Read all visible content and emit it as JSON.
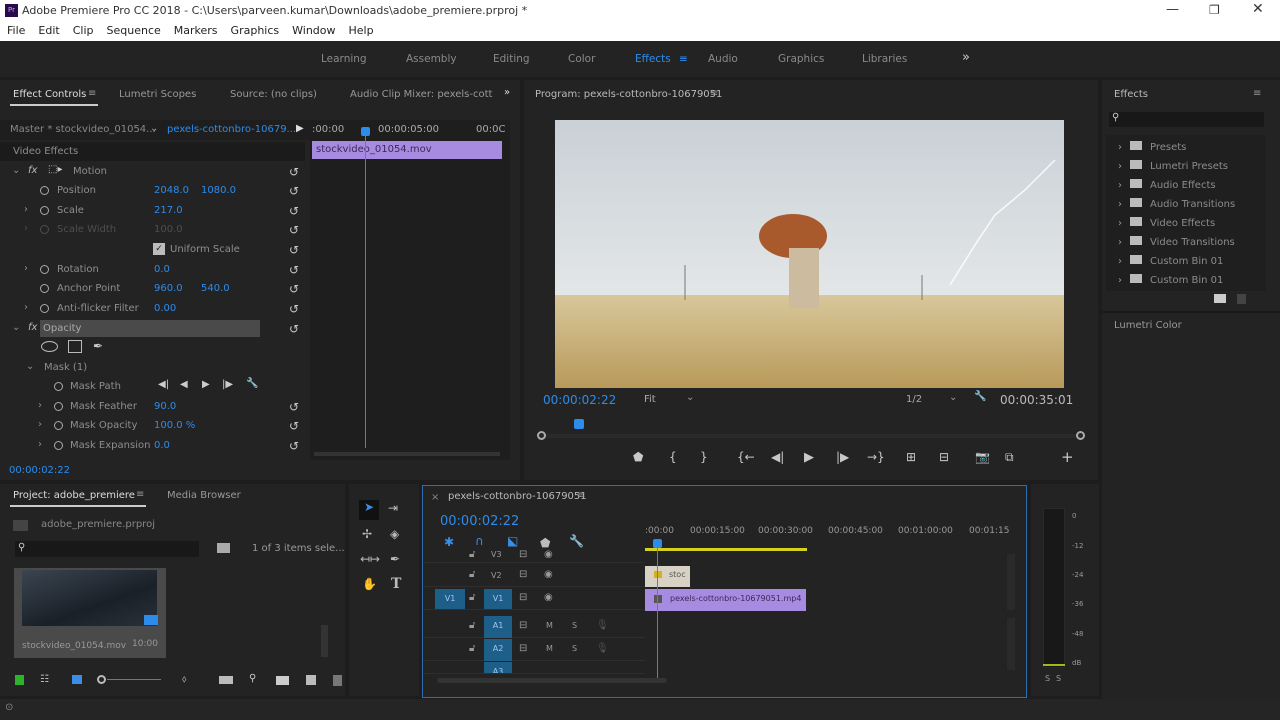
{
  "window": {
    "title": "Adobe Premiere Pro CC 2018 - C:\\Users\\parveen.kumar\\Downloads\\adobe_premiere.prproj *",
    "app_icon": "Pr",
    "controls": [
      "minimize",
      "restore",
      "close"
    ]
  },
  "menu": [
    "File",
    "Edit",
    "Clip",
    "Sequence",
    "Markers",
    "Graphics",
    "Window",
    "Help"
  ],
  "workspaces": {
    "items": [
      "Learning",
      "Assembly",
      "Editing",
      "Color",
      "Effects",
      "Audio",
      "Graphics",
      "Libraries"
    ],
    "active": "Effects",
    "more": "»"
  },
  "effect_controls": {
    "tabs": [
      "Effect Controls",
      "Lumetri Scopes",
      "Source: (no clips)",
      "Audio Clip Mixer: pexels-cott"
    ],
    "master": "Master * stockvideo_01054...",
    "sequence": "pexels-cottonbro-10679...",
    "section": "Video Effects",
    "ruler": [
      ":00:00",
      "00:00:05:00",
      "00:0C"
    ],
    "clip": "stockvideo_01054.mov",
    "motion": "Motion",
    "params": [
      {
        "name": "Position",
        "v1": "2048.0",
        "v2": "1080.0"
      },
      {
        "name": "Scale",
        "v1": "217.0"
      },
      {
        "name": "Scale Width",
        "v1": "100.0",
        "disabled": true
      },
      {
        "name": "Uniform Scale",
        "checkbox": true,
        "checked": true
      },
      {
        "name": "Rotation",
        "v1": "0.0"
      },
      {
        "name": "Anchor Point",
        "v1": "960.0",
        "v2": "540.0"
      },
      {
        "name": "Anti-flicker Filter",
        "v1": "0.00"
      }
    ],
    "opacity": "Opacity",
    "mask": "Mask (1)",
    "mask_params": [
      {
        "name": "Mask Path"
      },
      {
        "name": "Mask Feather",
        "v1": "90.0"
      },
      {
        "name": "Mask Opacity",
        "v1": "100.0 %"
      },
      {
        "name": "Mask Expansion",
        "v1": "0.0"
      }
    ],
    "timecode": "00:00:02:22"
  },
  "program": {
    "title": "Program: pexels-cottonbro-10679051",
    "timecode": "00:00:02:22",
    "fit": "Fit",
    "resolution": "1/2",
    "duration": "00:00:35:01",
    "playhead_fraction": 0.07
  },
  "effects_panel": {
    "title": "Effects",
    "search_placeholder": "",
    "items": [
      "Presets",
      "Lumetri Presets",
      "Audio Effects",
      "Audio Transitions",
      "Video Effects",
      "Video Transitions",
      "Custom Bin 01",
      "Custom Bin 01"
    ],
    "lumetri": "Lumetri Color"
  },
  "project": {
    "tabs": [
      "Project: adobe_premiere",
      "Media Browser"
    ],
    "file": "adobe_premiere.prproj",
    "selection": "1 of 3 items sele...",
    "clip_name": "stockvideo_01054.mov",
    "clip_duration": "10:00"
  },
  "timeline": {
    "title": "pexels-cottonbro-10679051",
    "timecode": "00:00:02:22",
    "ruler": [
      ":00:00",
      "00:00:15:00",
      "00:00:30:00",
      "00:00:45:00",
      "00:01:00:00",
      "00:01:15"
    ],
    "video_tracks": [
      "V3",
      "V2",
      "V1"
    ],
    "audio_tracks": [
      "A1",
      "A2",
      "A3"
    ],
    "source_patch": "V1",
    "clips": [
      {
        "track": "V2",
        "label": "stoc"
      },
      {
        "track": "V1",
        "label": "pexels-cottonbro-10679051.mp4"
      }
    ]
  },
  "meter": {
    "scale": [
      "0",
      "-12",
      "-24",
      "-36",
      "-48",
      "dB"
    ],
    "solo": [
      "S",
      "S"
    ]
  },
  "colors": {
    "accent": "#2d8ceb",
    "clip_video": "#a78be0",
    "clip_fx": "#d8d2c4",
    "work_area": "#d4d21f"
  }
}
